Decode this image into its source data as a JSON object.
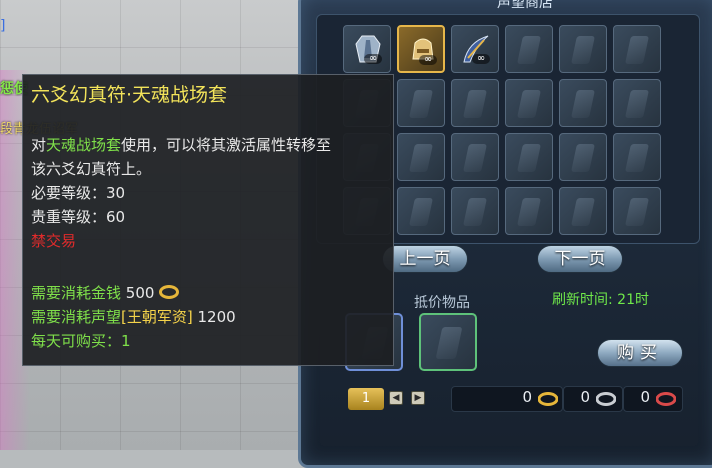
{
  "background": {
    "text_top": "]",
    "text_green": "惩使",
    "text_yellow": "段青龙伍诏军"
  },
  "shop": {
    "title": "声望商店",
    "grid_items": [
      {
        "name": "item-1",
        "filled": true,
        "badge": "∞"
      },
      {
        "name": "item-2",
        "filled": true,
        "selected": true,
        "badge": "∞"
      },
      {
        "name": "item-3",
        "filled": true,
        "badge": "∞"
      }
    ],
    "prev_page": "上一页",
    "next_page": "下一页",
    "pledge_label": "抵价物品",
    "refresh_label": "刷新时间: 21时",
    "buy_label": "购买",
    "quantity": "1",
    "currency": [
      {
        "value": "0",
        "icon": "gold-coin-icon",
        "color": "#e6b63a"
      },
      {
        "value": "0",
        "icon": "silver-coin-icon",
        "color": "#c9cdd2"
      },
      {
        "value": "0",
        "icon": "red-coin-icon",
        "color": "#d94a4a"
      }
    ]
  },
  "tooltip": {
    "title": "六爻幻真符·天魂战场套",
    "desc_prefix": "对",
    "desc_highlight": "天魂战场套",
    "desc_suffix": "使用，可以将其激活属性转移至",
    "desc_line2": "该六爻幻真符上。",
    "req_level": "必要等级：30",
    "value_level": "贵重等级：60",
    "no_trade": "禁交易",
    "cost_gold_label": "需要消耗金钱",
    "cost_gold_value": "500",
    "cost_rep_label": "需要消耗声望",
    "cost_rep_name": "[王朝军资]",
    "cost_rep_value": "1200",
    "daily_limit": "每天可购买：1"
  }
}
